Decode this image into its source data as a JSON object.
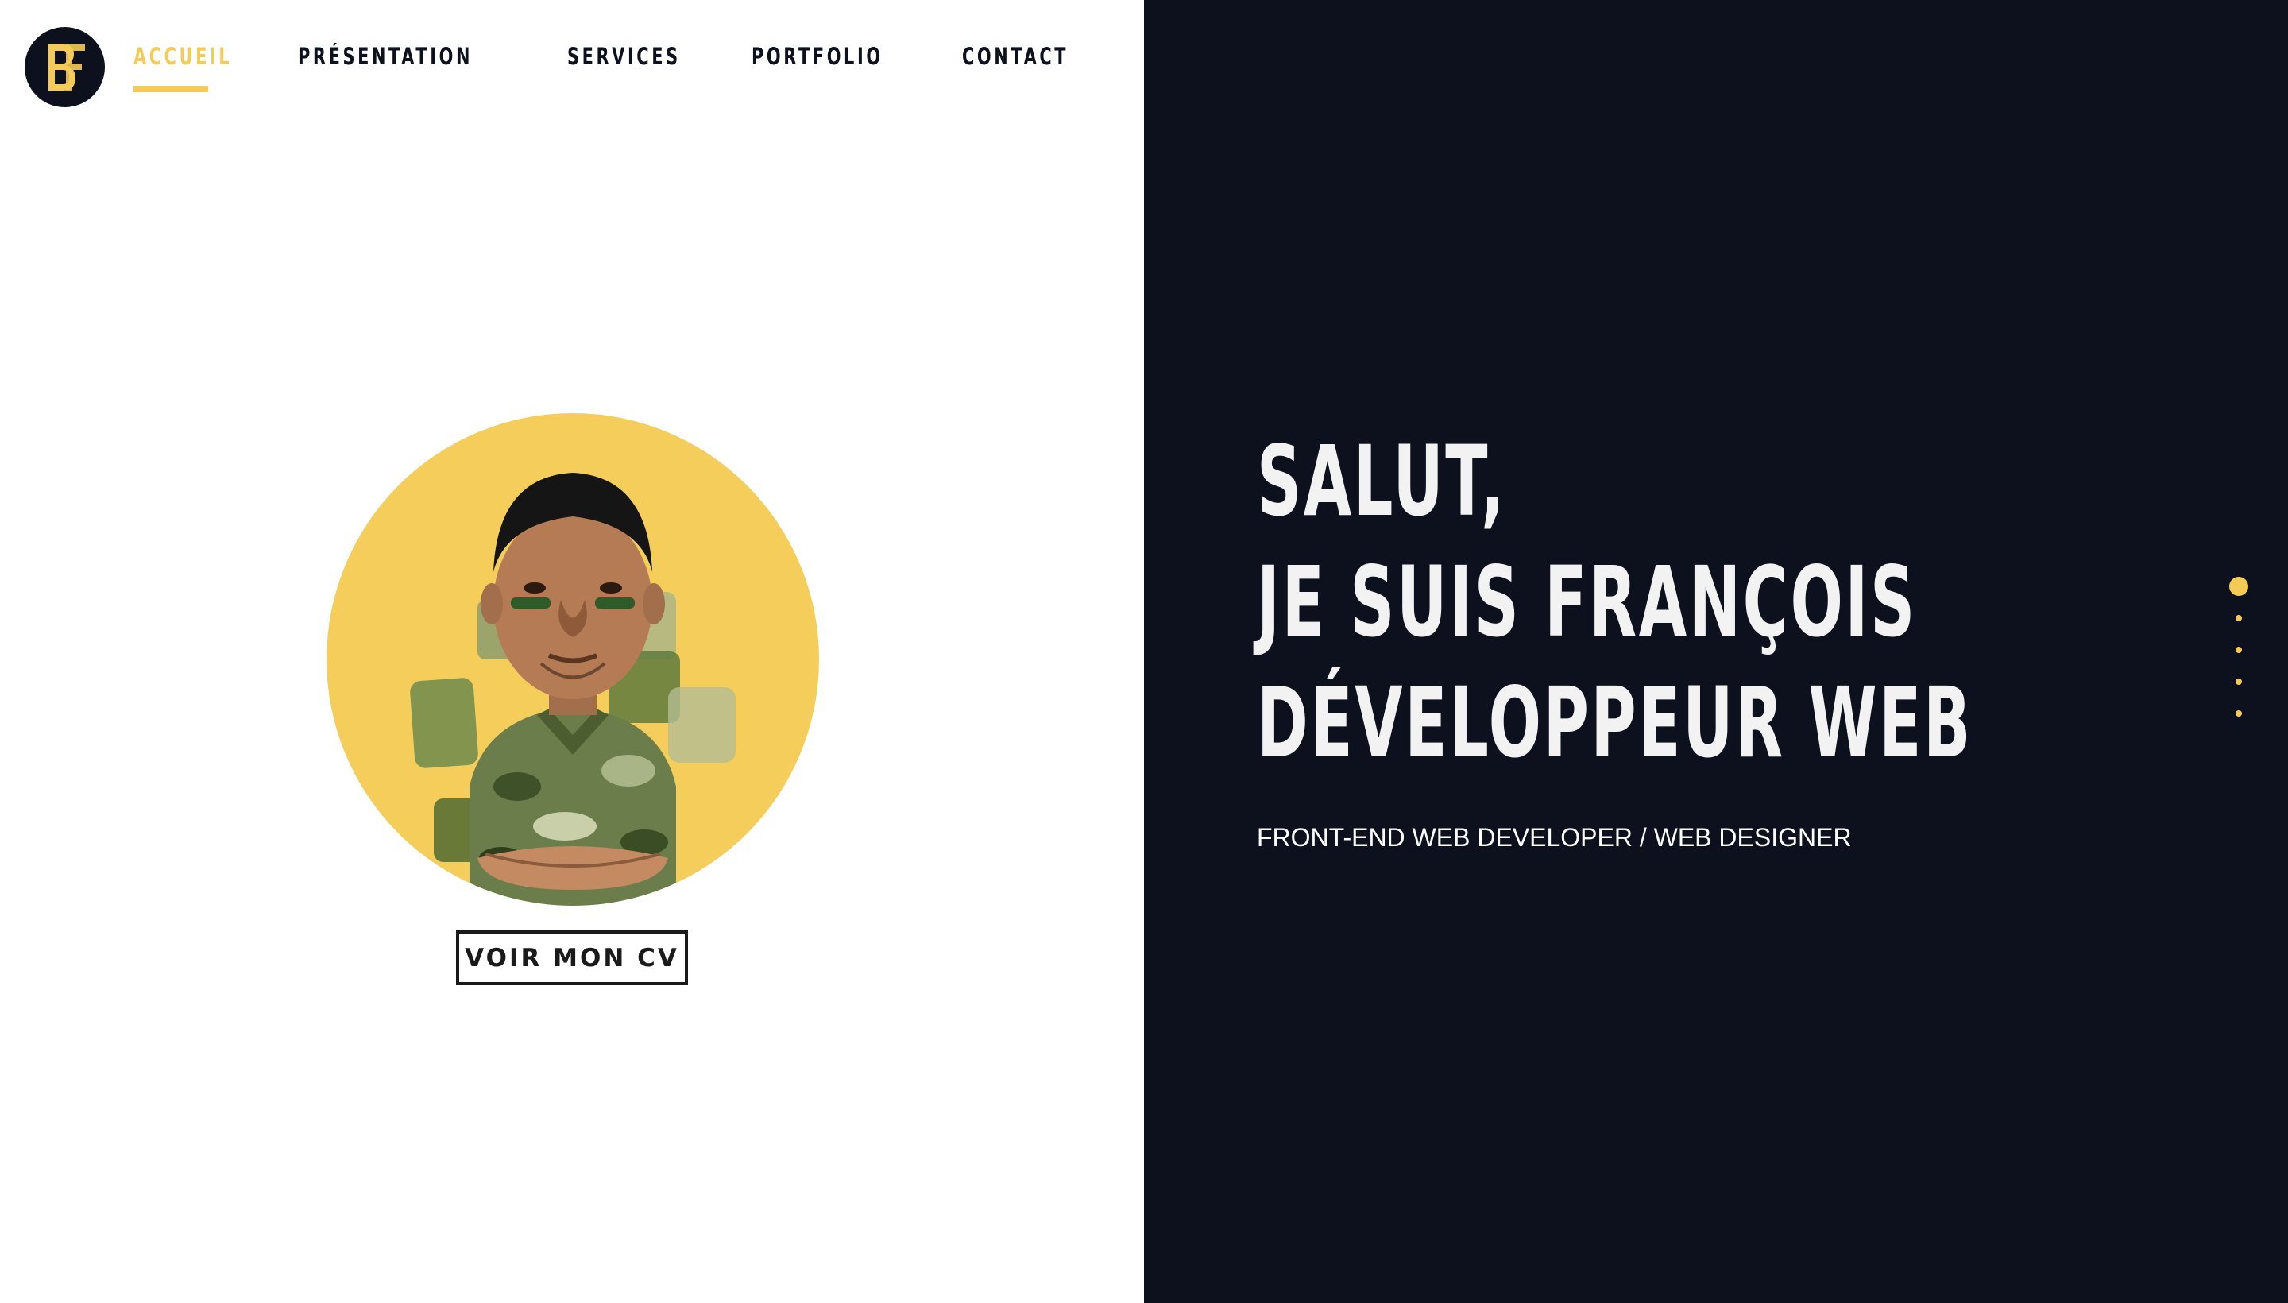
{
  "logo": {
    "letters": "BF",
    "icon": "bf-monogram-logo"
  },
  "nav": {
    "items": [
      {
        "label": "ACCUEIL",
        "active": true
      },
      {
        "label": "PRÉSENTATION",
        "active": false
      },
      {
        "label": "SERVICES",
        "active": false
      },
      {
        "label": "PORTFOLIO",
        "active": false
      },
      {
        "label": "CONTACT",
        "active": false
      }
    ]
  },
  "hero": {
    "lines": [
      "SALUT,",
      "JE SUIS FRANÇOIS",
      "DÉVELOPPEUR WEB"
    ],
    "subtitle": "FRONT-END WEB DEVELOPER / WEB DESIGNER"
  },
  "cv_button": {
    "label": "VOIR MON CV"
  },
  "slider": {
    "dot_count": 5,
    "active_index": 0
  },
  "colors": {
    "accent": "#f4cb57",
    "dark": "#0d111d",
    "light_text": "#f2f2f2",
    "avatar_bg": "#f4cd5a"
  },
  "avatar": {
    "icon": "cartoon-avatar-portrait"
  }
}
